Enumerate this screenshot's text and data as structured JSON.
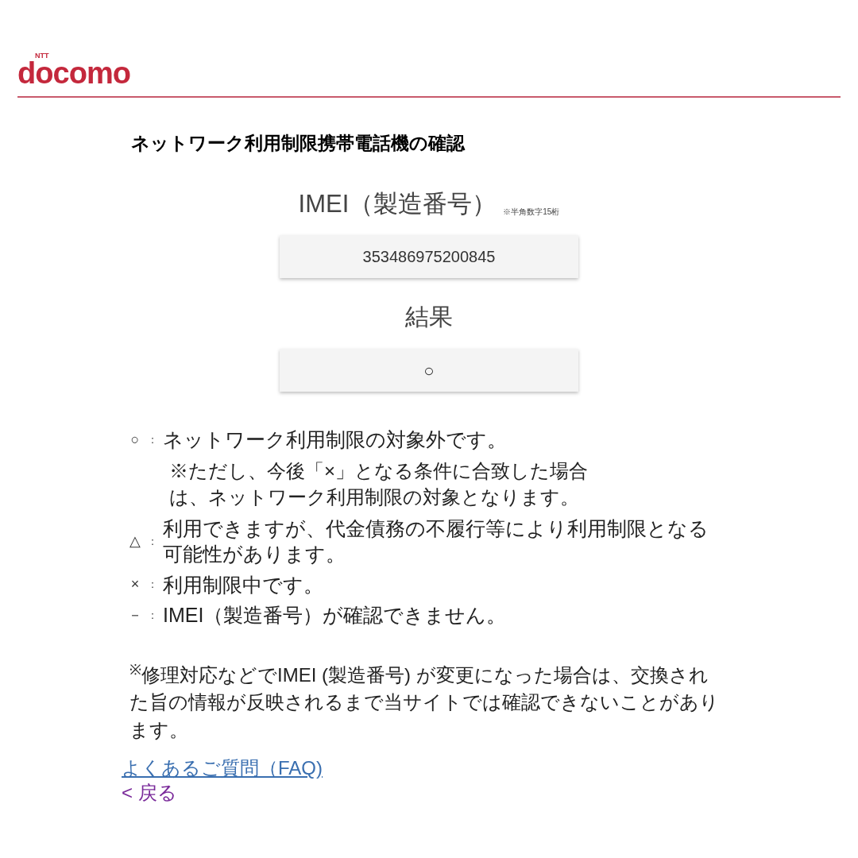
{
  "logo": {
    "small": "NTT",
    "name": "docomo"
  },
  "title": "ネットワーク利用制限携帯電話機の確認",
  "imei": {
    "label": "IMEI（製造番号）",
    "hint": "※半角数字15桁",
    "value": "353486975200845"
  },
  "result": {
    "label": "結果",
    "value": "○"
  },
  "legend": [
    {
      "symbol": "○",
      "colon": "：",
      "text": "ネットワーク利用制限の対象外です。",
      "note": "※ただし、今後「×」となる条件に合致した場合は、ネットワーク利用制限の対象となります。"
    },
    {
      "symbol": "△",
      "colon": "：",
      "text": "利用できますが、代金債務の不履行等により利用制限となる可能性があります。"
    },
    {
      "symbol": "×",
      "colon": "：",
      "text": "利用制限中です。"
    },
    {
      "symbol": "－",
      "colon": "：",
      "text": "IMEI（製造番号）が確認できません。"
    }
  ],
  "footnote": "$^{※}$修理対応などでIMEI (製造番号) が変更になった場合は、交換された旨の情報が反映されるまで当サイトでは確認できないことがあります。",
  "links": [
    {
      "text": "よくあるご質問（FAQ)",
      "visited": false
    },
    {
      "text": "< 戻る",
      "visited": true
    }
  ]
}
